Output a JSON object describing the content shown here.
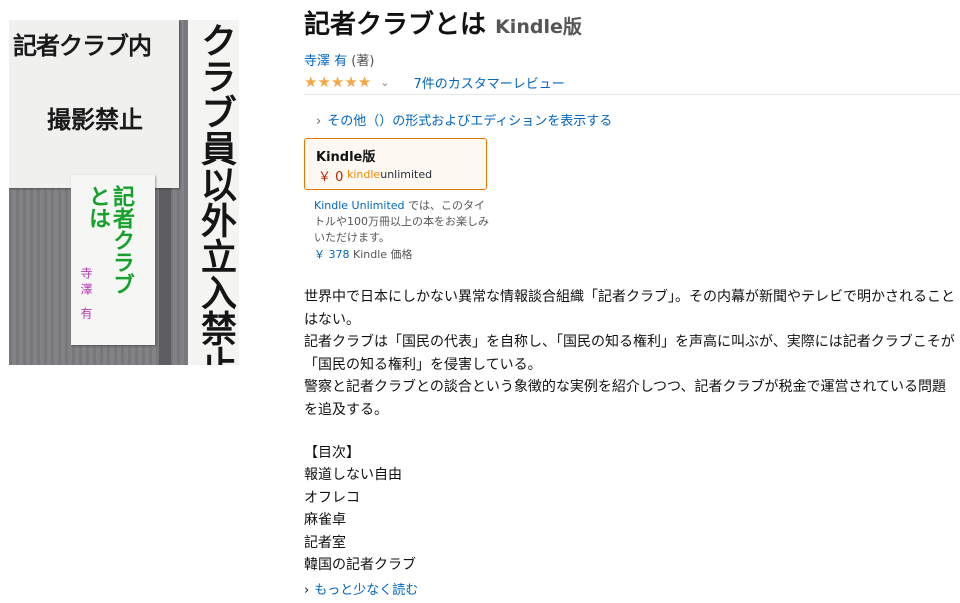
{
  "cover": {
    "sign_top_left_line1": "記者クラブ内",
    "sign_top_left_line2": "撮影禁止",
    "sign_right_vertical": "クラブ員以外立入禁止",
    "book_title_col1": "記者クラブ",
    "book_title_col2": "とは",
    "book_author": "寺澤 有"
  },
  "product": {
    "title": "記者クラブとは",
    "format_label": "Kindle版",
    "author_name": "寺澤 有",
    "author_role": " (著)",
    "stars": "★★★★★",
    "rating_value": 5,
    "review_link": "7件のカスタマーレビュー",
    "more_formats": "その他（）の形式およびエディションを表示する"
  },
  "kindle_box": {
    "title": "Kindle版",
    "price": "￥ 0",
    "ku_logo_part1": "kindle",
    "ku_logo_part2": "unlimited"
  },
  "ku_note": {
    "link": "Kindle Unlimited",
    "text": " では、このタイトルや100万冊以上の本をお楽しみいただけます。"
  },
  "kindle_price": {
    "value": "￥ 378",
    "label": " Kindle 価格"
  },
  "description": [
    "世界中で日本にしかない異常な情報談合組織「記者クラブ」。その内幕が新聞やテレビで明かされることはない。",
    "記者クラブは「国民の代表」を自称し、「国民の知る権利」を声高に叫ぶが、実際には記者クラブこそが「国民の知る権利」を侵害している。",
    "警察と記者クラブとの談合という象徴的な実例を紹介しつつ、記者クラブが税金で運営されている問題を追及する。"
  ],
  "toc": {
    "heading": "【目次】",
    "items": [
      "報道しない自由",
      "オフレコ",
      "麻雀卓",
      "記者室",
      "韓国の記者クラブ"
    ]
  },
  "read_less": "もっと少なく読む",
  "colors": {
    "link": "#0066c0",
    "price": "#b12704",
    "star": "#f3a847",
    "box_border": "#e77600",
    "cover_green": "#16a12c",
    "cover_purple": "#b23bb4"
  }
}
